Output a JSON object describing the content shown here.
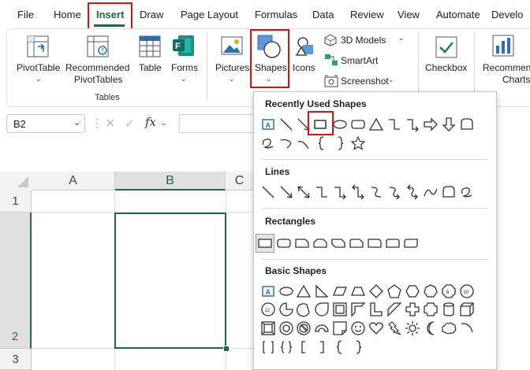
{
  "menu": {
    "tabs": [
      "File",
      "Home",
      "Insert",
      "Draw",
      "Page Layout",
      "Formulas",
      "Data",
      "Review",
      "View",
      "Automate",
      "Develo"
    ],
    "active_tab": "Insert"
  },
  "ribbon": {
    "pivot_table": "PivotTable",
    "recommended_pivot_line1": "Recommended",
    "recommended_pivot_line2": "PivotTables",
    "table": "Table",
    "forms": "Forms",
    "tables_group": "Tables",
    "pictures": "Pictures",
    "shapes": "Shapes",
    "icons": "Icons",
    "models_3d": "3D Models",
    "smartart": "SmartArt",
    "screenshot": "Screenshot",
    "checkbox": "Checkbox",
    "recommended_charts_line1": "Recommen",
    "recommended_charts_line2": "Charts"
  },
  "formula_bar": {
    "name_box": "B2",
    "fx": "fx"
  },
  "grid": {
    "columns": [
      "A",
      "B",
      "C"
    ],
    "rows": [
      "1",
      "2",
      "3"
    ],
    "selected_cell": "B2"
  },
  "shapes_menu": {
    "recently_used_title": "Recently Used Shapes",
    "lines_title": "Lines",
    "rectangles_title": "Rectangles",
    "basic_shapes_title": "Basic Shapes"
  },
  "colors": {
    "accent": "#1e6b3c",
    "highlight": "#e01010"
  }
}
